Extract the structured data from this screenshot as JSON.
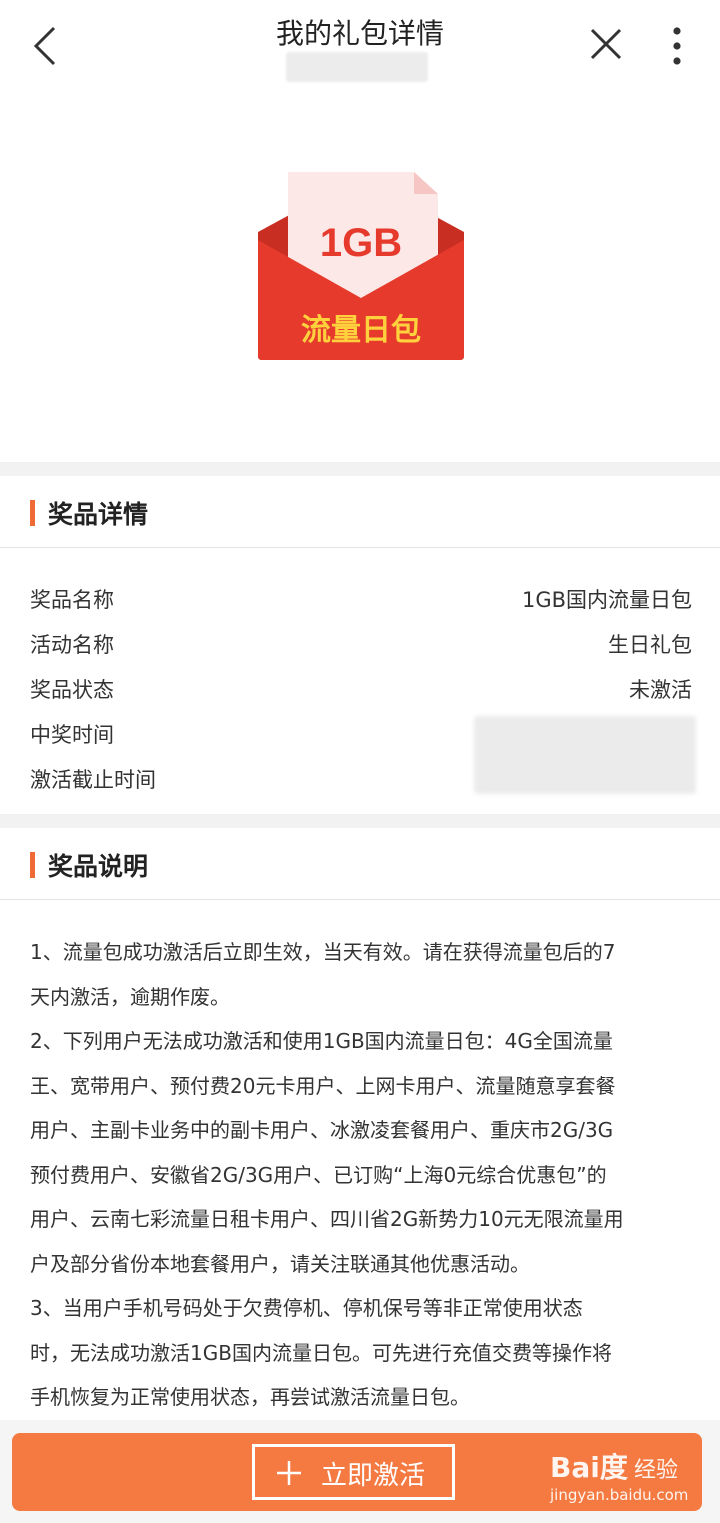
{
  "header": {
    "title": "我的礼包详情"
  },
  "hero": {
    "card_amount": "1GB",
    "card_name": "流量日包"
  },
  "prize_details": {
    "section_title": "奖品详情",
    "rows": [
      {
        "label": "奖品名称",
        "value": "1GB国内流量日包"
      },
      {
        "label": "活动名称",
        "value": "生日礼包"
      },
      {
        "label": "奖品状态",
        "value": "未激活"
      },
      {
        "label": "中奖时间",
        "value": ""
      },
      {
        "label": "激活截止时间",
        "value": ""
      }
    ]
  },
  "prize_description": {
    "section_title": "奖品说明",
    "lines": [
      "1、流量包成功激活后立即生效，当天有效。请在获得流量包后的7",
      "天内激活，逾期作废。",
      "2、下列用户无法成功激活和使用1GB国内流量日包：4G全国流量",
      "王、宽带用户、预付费20元卡用户、上网卡用户、流量随意享套餐",
      "用户、主副卡业务中的副卡用户、冰激凌套餐用户、重庆市2G/3G",
      "预付费用户、安徽省2G/3G用户、已订购“上海0元综合优惠包”的",
      "用户、云南七彩流量日租卡用户、四川省2G新势力10元无限流量用",
      "户及部分省份本地套餐用户，请关注联通其他优惠活动。",
      "3、当用户手机号码处于欠费停机、停机保号等非正常使用状态",
      "时，无法成功激活1GB国内流量日包。可先进行充值交费等操作将",
      "手机恢复为正常使用状态，再尝试激活流量日包。"
    ]
  },
  "footer": {
    "activate_label": "立即激活"
  },
  "watermark": {
    "brand": "Bai度",
    "product": "经验",
    "url": "jingyan.baidu.com"
  },
  "colors": {
    "accent": "#f06a35",
    "button": "#f47a42",
    "envelope": "#e53a2c",
    "envelope_text": "#ffd13c",
    "card": "#fde8e8"
  },
  "icons": {
    "back": "chevron-left-icon",
    "close": "close-icon",
    "more": "more-vertical-icon",
    "plus": "plus-icon",
    "gift": "red-envelope-icon"
  }
}
